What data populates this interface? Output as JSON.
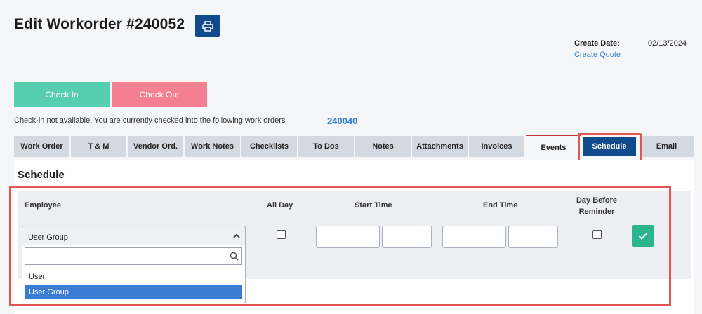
{
  "header": {
    "title": "Edit Workorder #240052",
    "print_icon": "printer-icon",
    "create_date_label": "Create Date:",
    "create_date_value": "02/13/2024",
    "create_quote_link": "Create Quote"
  },
  "actions": {
    "check_in": "Check In",
    "check_out": "Check Out"
  },
  "checkin_status": {
    "message": "Check-in not available. You are currently checked into the following work orders",
    "workorder_link": "240040"
  },
  "tabs": [
    {
      "label": "Work Order"
    },
    {
      "label": "T & M"
    },
    {
      "label": "Vendor Ord."
    },
    {
      "label": "Work Notes"
    },
    {
      "label": "Checklists"
    },
    {
      "label": "To Dos"
    },
    {
      "label": "Notes"
    },
    {
      "label": "Attachments"
    },
    {
      "label": "Invoices"
    },
    {
      "label": "Events"
    },
    {
      "label": "Schedule"
    },
    {
      "label": "Email"
    }
  ],
  "active_tab": "Schedule",
  "schedule": {
    "title": "Schedule",
    "columns": {
      "employee": "Employee",
      "all_day": "All Day",
      "start_time": "Start Time",
      "end_time": "End Time",
      "reminder_line1": "Day Before",
      "reminder_line2": "Reminder"
    },
    "employee_select": {
      "value": "User Group",
      "search_placeholder": "",
      "options": [
        "User",
        "User Group"
      ],
      "selected": "User Group"
    },
    "start_date_value": "",
    "start_time_value": "",
    "end_date_value": "",
    "end_time_value": "",
    "save_icon": "checkmark-icon"
  },
  "colors": {
    "primary": "#124a8e",
    "check_in": "#56ceb0",
    "check_out": "#f47f90",
    "link": "#2f7fd1",
    "save": "#2bb58f",
    "highlight": "#e25555",
    "selected_option": "#3a7bd5"
  }
}
